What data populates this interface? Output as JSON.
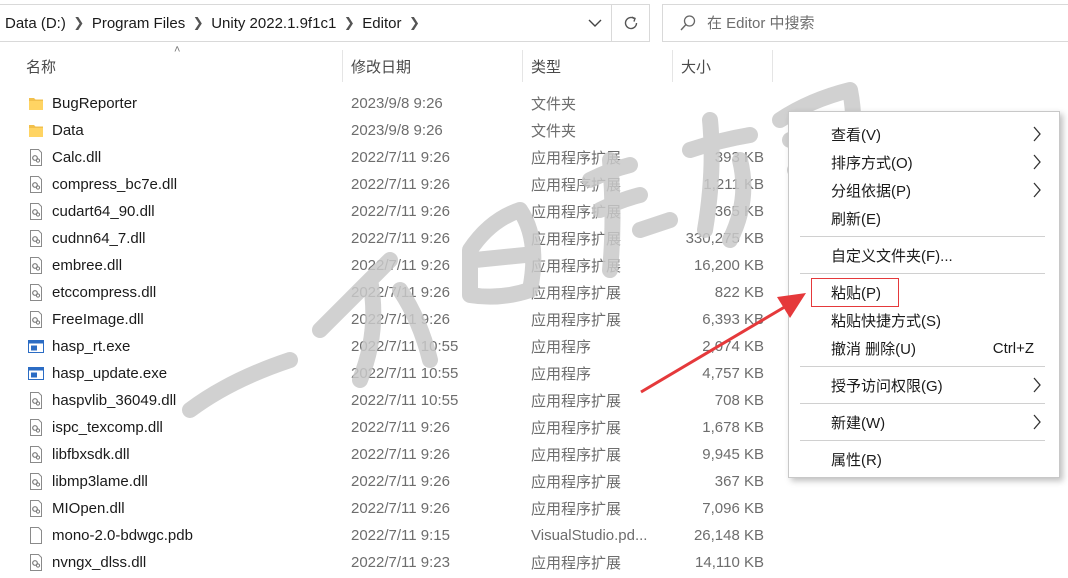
{
  "address_bar": {
    "crumbs": [
      "Data (D:)",
      "Program Files",
      "Unity 2022.1.9f1c1",
      "Editor"
    ],
    "dropdown_icon": "chevron-down-icon",
    "refresh_icon": "refresh-icon"
  },
  "search": {
    "placeholder": "在 Editor 中搜索",
    "icon": "search-icon"
  },
  "columns": {
    "name": "名称",
    "date": "修改日期",
    "type": "类型",
    "size": "大小"
  },
  "files": [
    {
      "name": "BugReporter",
      "date": "2023/9/8 9:26",
      "type": "文件夹",
      "size": "",
      "icon": "folder-icon"
    },
    {
      "name": "Data",
      "date": "2023/9/8 9:26",
      "type": "文件夹",
      "size": "",
      "icon": "folder-icon"
    },
    {
      "name": "Calc.dll",
      "date": "2022/7/11 9:26",
      "type": "应用程序扩展",
      "size": "393 KB",
      "icon": "dll-icon"
    },
    {
      "name": "compress_bc7e.dll",
      "date": "2022/7/11 9:26",
      "type": "应用程序扩展",
      "size": "1,211 KB",
      "icon": "dll-icon"
    },
    {
      "name": "cudart64_90.dll",
      "date": "2022/7/11 9:26",
      "type": "应用程序扩展",
      "size": "365 KB",
      "icon": "dll-icon"
    },
    {
      "name": "cudnn64_7.dll",
      "date": "2022/7/11 9:26",
      "type": "应用程序扩展",
      "size": "330,275 KB",
      "icon": "dll-icon"
    },
    {
      "name": "embree.dll",
      "date": "2022/7/11 9:26",
      "type": "应用程序扩展",
      "size": "16,200 KB",
      "icon": "dll-icon"
    },
    {
      "name": "etccompress.dll",
      "date": "2022/7/11 9:26",
      "type": "应用程序扩展",
      "size": "822 KB",
      "icon": "dll-icon"
    },
    {
      "name": "FreeImage.dll",
      "date": "2022/7/11 9:26",
      "type": "应用程序扩展",
      "size": "6,393 KB",
      "icon": "dll-icon"
    },
    {
      "name": "hasp_rt.exe",
      "date": "2022/7/11 10:55",
      "type": "应用程序",
      "size": "2,074 KB",
      "icon": "exe-icon"
    },
    {
      "name": "hasp_update.exe",
      "date": "2022/7/11 10:55",
      "type": "应用程序",
      "size": "4,757 KB",
      "icon": "exe-icon"
    },
    {
      "name": "haspvlib_36049.dll",
      "date": "2022/7/11 10:55",
      "type": "应用程序扩展",
      "size": "708 KB",
      "icon": "dll-icon"
    },
    {
      "name": "ispc_texcomp.dll",
      "date": "2022/7/11 9:26",
      "type": "应用程序扩展",
      "size": "1,678 KB",
      "icon": "dll-icon"
    },
    {
      "name": "libfbxsdk.dll",
      "date": "2022/7/11 9:26",
      "type": "应用程序扩展",
      "size": "9,945 KB",
      "icon": "dll-icon"
    },
    {
      "name": "libmp3lame.dll",
      "date": "2022/7/11 9:26",
      "type": "应用程序扩展",
      "size": "367 KB",
      "icon": "dll-icon"
    },
    {
      "name": "MIOpen.dll",
      "date": "2022/7/11 9:26",
      "type": "应用程序扩展",
      "size": "7,096 KB",
      "icon": "dll-icon"
    },
    {
      "name": "mono-2.0-bdwgc.pdb",
      "date": "2022/7/11 9:15",
      "type": "VisualStudio.pd...",
      "size": "26,148 KB",
      "icon": "file-icon"
    },
    {
      "name": "nvngx_dlss.dll",
      "date": "2022/7/11 9:23",
      "type": "应用程序扩展",
      "size": "14,110 KB",
      "icon": "dll-icon"
    }
  ],
  "context_menu": {
    "view": "查看(V)",
    "sort": "排序方式(O)",
    "group": "分组依据(P)",
    "refresh": "刷新(E)",
    "customize": "自定义文件夹(F)...",
    "paste": "粘贴(P)",
    "paste_shortcut": "粘贴快捷方式(S)",
    "undo_delete": "撤消 删除(U)",
    "undo_shortcut": "Ctrl+Z",
    "grant_access": "授予访问权限(G)",
    "new": "新建(W)",
    "properties": "属性(R)"
  },
  "colors": {
    "highlight_border": "#e5393b",
    "arrow": "#e5393b",
    "folder": "#f2c04c",
    "exe_icon": "#2b6cc4"
  }
}
